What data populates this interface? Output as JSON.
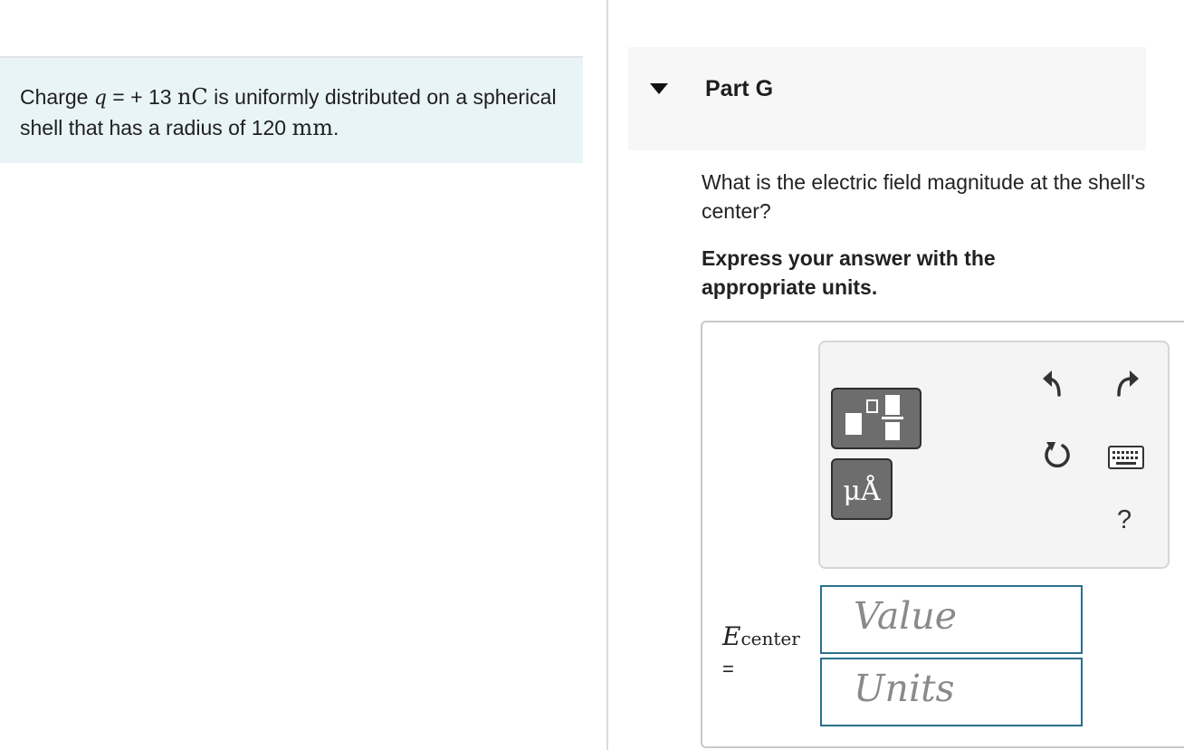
{
  "problem": {
    "prefix": "Charge ",
    "var": "q",
    "eq": " = + 13 ",
    "unit1": "nC",
    "middle": " is uniformly distributed on a spherical shell that has a radius of 120 ",
    "unit2": "mm",
    "suffix": "."
  },
  "part": {
    "title": "Part G"
  },
  "question": "What is the electric field magnitude at the shell's center?",
  "instruction": "Express your answer with the appropriate units.",
  "toolbar": {
    "units_label": "μÅ",
    "help_label": "?",
    "icons": [
      "templates-icon",
      "undo-icon",
      "redo-icon",
      "reset-icon",
      "keyboard-icon"
    ]
  },
  "answer": {
    "var": "E",
    "sub": "center",
    "equals": "=",
    "value_placeholder": "Value",
    "units_placeholder": "Units"
  }
}
